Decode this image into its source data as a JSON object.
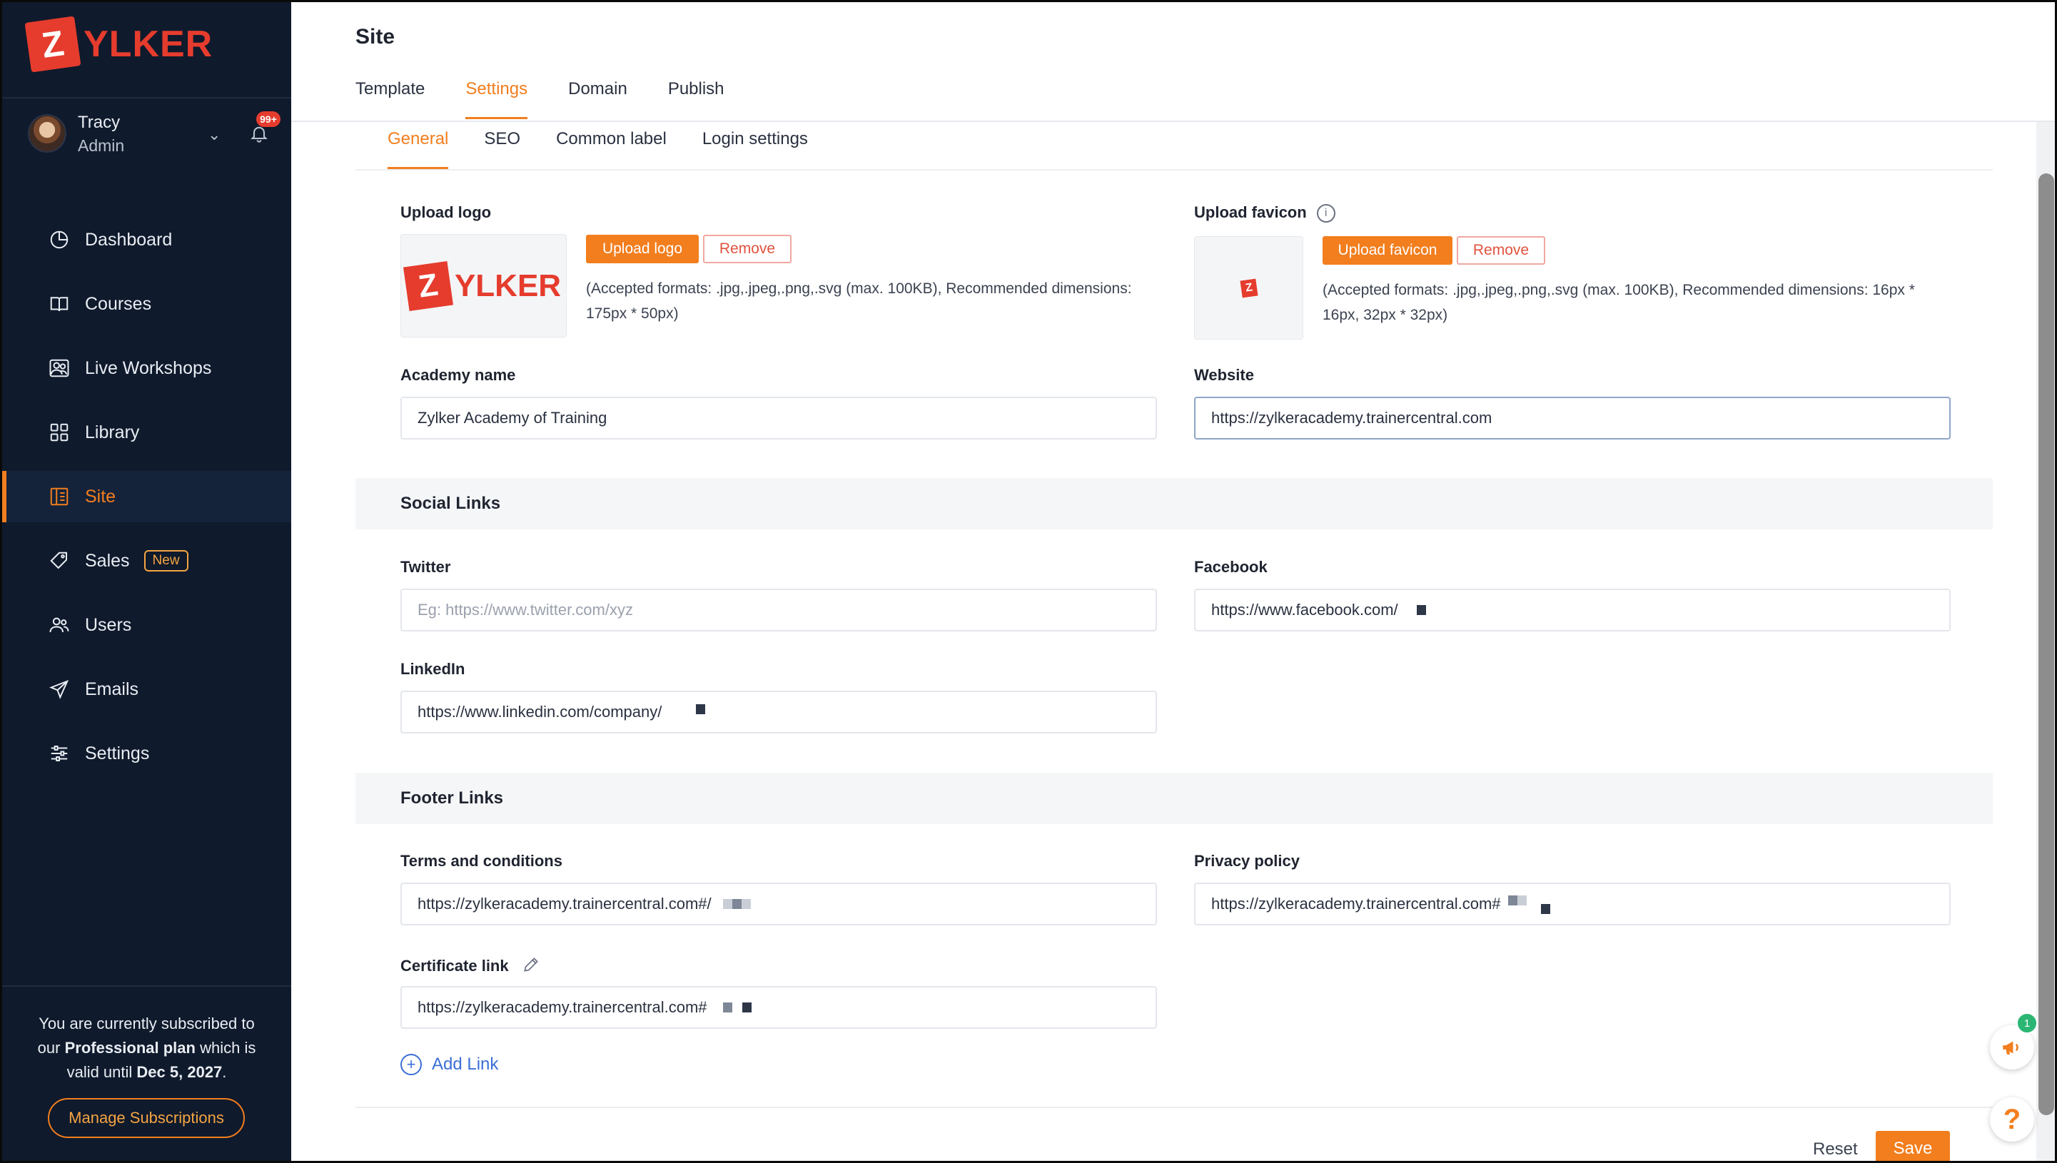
{
  "brand": {
    "logo_letter": "Z",
    "logo_text": "YLKER",
    "color": "#e53c2e"
  },
  "profile": {
    "name": "Tracy",
    "role": "Admin",
    "notification_badge": "99+"
  },
  "sidebar": {
    "items": [
      {
        "label": "Dashboard",
        "icon": "dashboard-icon"
      },
      {
        "label": "Courses",
        "icon": "courses-icon"
      },
      {
        "label": "Live Workshops",
        "icon": "live-workshops-icon"
      },
      {
        "label": "Library",
        "icon": "library-icon"
      },
      {
        "label": "Site",
        "icon": "site-icon",
        "active": true
      },
      {
        "label": "Sales",
        "icon": "sales-tag-icon",
        "badge": "New"
      },
      {
        "label": "Users",
        "icon": "users-icon"
      },
      {
        "label": "Emails",
        "icon": "emails-send-icon"
      },
      {
        "label": "Settings",
        "icon": "settings-sliders-icon"
      }
    ],
    "subscription": {
      "t1": "You are currently subscribed to",
      "t2": "our ",
      "plan": "Professional plan",
      "t3": " which is",
      "t4": "valid until ",
      "date": "Dec 5, 2027",
      "t5": "."
    },
    "manage_label": "Manage Subscriptions"
  },
  "header": {
    "title": "Site",
    "tabs": [
      "Template",
      "Settings",
      "Domain",
      "Publish"
    ],
    "active_tab": "Settings"
  },
  "subtabs": [
    "General",
    "SEO",
    "Common label",
    "Login settings"
  ],
  "general": {
    "upload_logo_label": "Upload logo",
    "upload_logo_btn": "Upload logo",
    "remove_btn": "Remove",
    "logo_hint": "(Accepted formats: .jpg,.jpeg,.png,.svg (max. 100KB), Recommended dimensions: 175px * 50px)",
    "upload_favicon_label": "Upload favicon",
    "upload_favicon_btn": "Upload favicon",
    "favicon_hint": "(Accepted formats: .jpg,.jpeg,.png,.svg (max. 100KB), Recommended dimensions: 16px * 16px, 32px * 32px)",
    "academy_name_label": "Academy name",
    "academy_name_value": "Zylker Academy of Training",
    "website_label": "Website",
    "website_value": "https://zylkeracademy.trainercentral.com"
  },
  "social": {
    "heading": "Social Links",
    "twitter_label": "Twitter",
    "twitter_placeholder": "Eg: https://www.twitter.com/xyz",
    "facebook_label": "Facebook",
    "facebook_value": "https://www.facebook.com/",
    "linkedin_label": "LinkedIn",
    "linkedin_value": "https://www.linkedin.com/company/"
  },
  "footer_links": {
    "heading": "Footer Links",
    "terms_label": "Terms and conditions",
    "terms_value": "https://zylkeracademy.trainercentral.com#/",
    "privacy_label": "Privacy policy",
    "privacy_value": "https://zylkeracademy.trainercentral.com#",
    "certificate_label": "Certificate link",
    "certificate_value": "https://zylkeracademy.trainercentral.com#",
    "add_link_label": "Add Link"
  },
  "actions": {
    "reset": "Reset",
    "save": "Save"
  },
  "fab": {
    "announce_count": "1",
    "help": "?"
  },
  "colors": {
    "accent": "#f27e1e",
    "sidebar_bg": "#0f1a2c",
    "link": "#3b6fd6"
  }
}
